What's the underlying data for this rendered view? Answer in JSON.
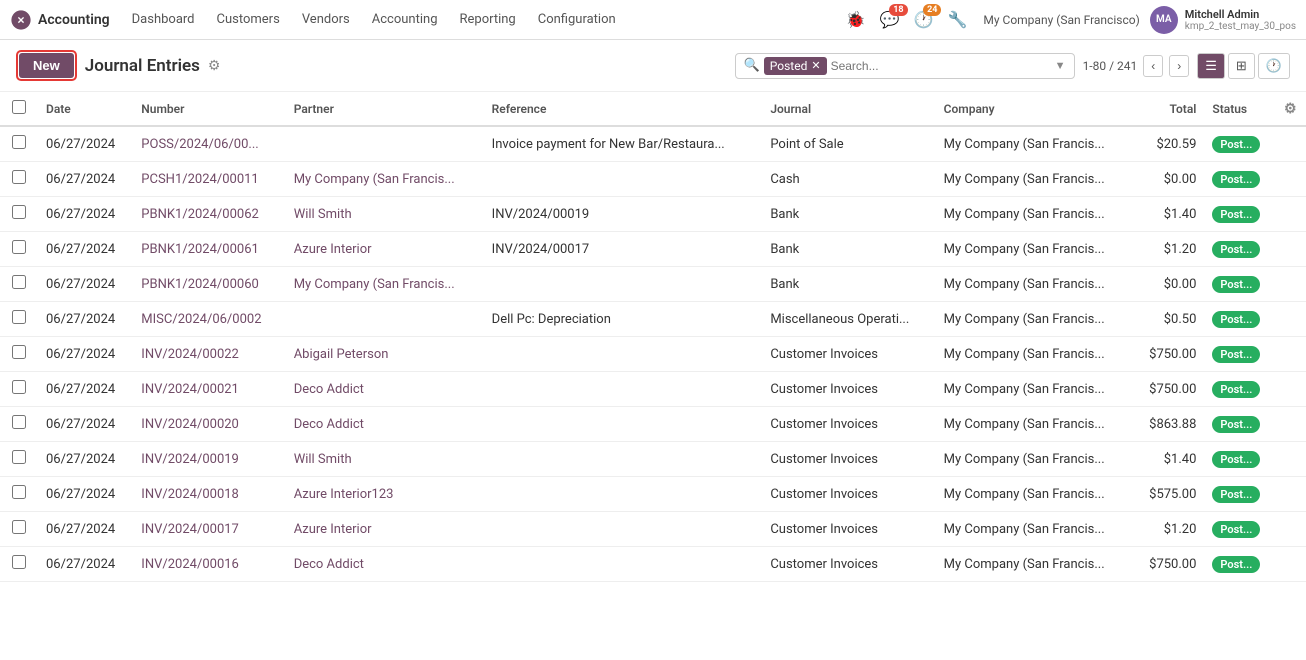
{
  "app": {
    "logo_text": "✕",
    "name": "Accounting"
  },
  "nav": {
    "items": [
      "Dashboard",
      "Customers",
      "Vendors",
      "Accounting",
      "Reporting",
      "Configuration"
    ],
    "bug_icon": "🐞",
    "chat_badge": "18",
    "clock_badge": "24",
    "wrench_icon": "🔧",
    "company": "My Company (San Francisco)",
    "user_name": "Mitchell Admin",
    "user_sub": "kmp_2_test_may_30_pos",
    "avatar_initials": "MA"
  },
  "toolbar": {
    "new_label": "New",
    "page_title": "Journal Entries"
  },
  "search": {
    "filter_label": "Posted",
    "placeholder": "Search...",
    "pagination": "1-80 / 241"
  },
  "table": {
    "columns": [
      "",
      "Date",
      "Number",
      "Partner",
      "Reference",
      "Journal",
      "Company",
      "Total",
      "Status",
      ""
    ],
    "rows": [
      {
        "date": "06/27/2024",
        "number": "POSS/2024/06/00...",
        "partner": "",
        "reference": "Invoice payment for New Bar/Restaura...",
        "journal": "Point of Sale",
        "company": "My Company (San Francis...",
        "total": "$20.59",
        "status": "Post..."
      },
      {
        "date": "06/27/2024",
        "number": "PCSH1/2024/00011",
        "partner": "My Company (San Francis...",
        "reference": "",
        "journal": "Cash",
        "company": "My Company (San Francis...",
        "total": "$0.00",
        "status": "Post..."
      },
      {
        "date": "06/27/2024",
        "number": "PBNK1/2024/00062",
        "partner": "Will Smith",
        "reference": "INV/2024/00019",
        "journal": "Bank",
        "company": "My Company (San Francis...",
        "total": "$1.40",
        "status": "Post..."
      },
      {
        "date": "06/27/2024",
        "number": "PBNK1/2024/00061",
        "partner": "Azure Interior",
        "reference": "INV/2024/00017",
        "journal": "Bank",
        "company": "My Company (San Francis...",
        "total": "$1.20",
        "status": "Post..."
      },
      {
        "date": "06/27/2024",
        "number": "PBNK1/2024/00060",
        "partner": "My Company (San Francis...",
        "reference": "",
        "journal": "Bank",
        "company": "My Company (San Francis...",
        "total": "$0.00",
        "status": "Post..."
      },
      {
        "date": "06/27/2024",
        "number": "MISC/2024/06/0002",
        "partner": "",
        "reference": "Dell Pc: Depreciation",
        "journal": "Miscellaneous Operati...",
        "company": "My Company (San Francis...",
        "total": "$0.50",
        "status": "Post..."
      },
      {
        "date": "06/27/2024",
        "number": "INV/2024/00022",
        "partner": "Abigail Peterson",
        "reference": "",
        "journal": "Customer Invoices",
        "company": "My Company (San Francis...",
        "total": "$750.00",
        "status": "Post..."
      },
      {
        "date": "06/27/2024",
        "number": "INV/2024/00021",
        "partner": "Deco Addict",
        "reference": "",
        "journal": "Customer Invoices",
        "company": "My Company (San Francis...",
        "total": "$750.00",
        "status": "Post..."
      },
      {
        "date": "06/27/2024",
        "number": "INV/2024/00020",
        "partner": "Deco Addict",
        "reference": "",
        "journal": "Customer Invoices",
        "company": "My Company (San Francis...",
        "total": "$863.88",
        "status": "Post..."
      },
      {
        "date": "06/27/2024",
        "number": "INV/2024/00019",
        "partner": "Will Smith",
        "reference": "",
        "journal": "Customer Invoices",
        "company": "My Company (San Francis...",
        "total": "$1.40",
        "status": "Post..."
      },
      {
        "date": "06/27/2024",
        "number": "INV/2024/00018",
        "partner": "Azure Interior123",
        "reference": "",
        "journal": "Customer Invoices",
        "company": "My Company (San Francis...",
        "total": "$575.00",
        "status": "Post..."
      },
      {
        "date": "06/27/2024",
        "number": "INV/2024/00017",
        "partner": "Azure Interior",
        "reference": "",
        "journal": "Customer Invoices",
        "company": "My Company (San Francis...",
        "total": "$1.20",
        "status": "Post..."
      },
      {
        "date": "06/27/2024",
        "number": "INV/2024/00016",
        "partner": "Deco Addict",
        "reference": "",
        "journal": "Customer Invoices",
        "company": "My Company (San Francis...",
        "total": "$750.00",
        "status": "Post..."
      }
    ]
  },
  "colors": {
    "brand": "#714b67",
    "posted": "#27ae60",
    "danger": "#e53935"
  }
}
